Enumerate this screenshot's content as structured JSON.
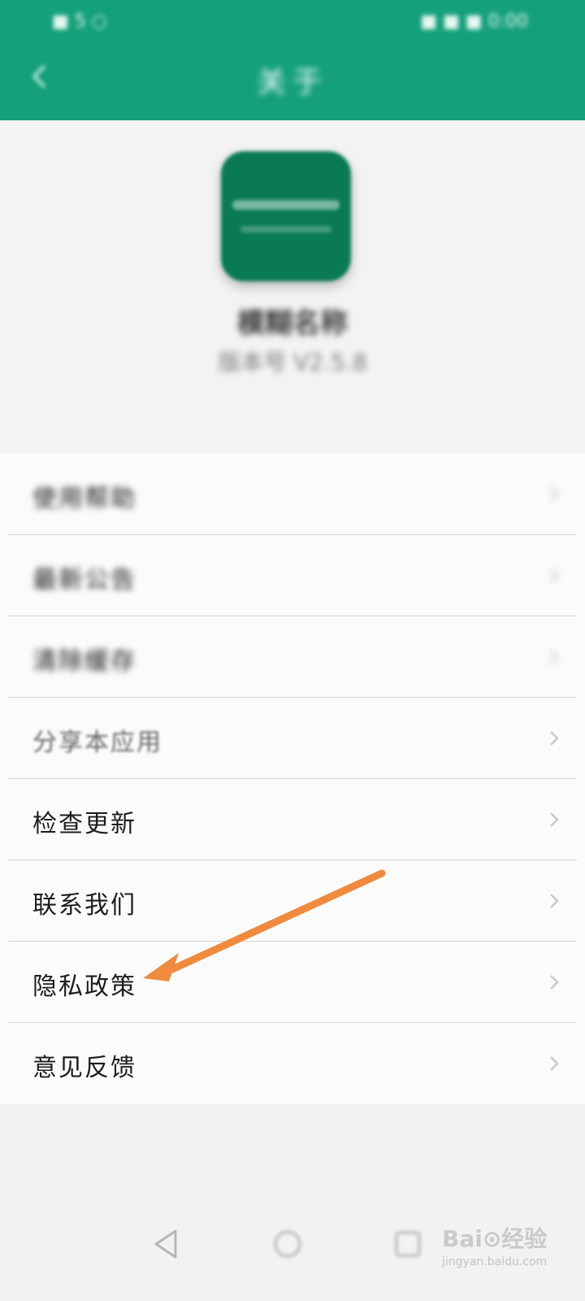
{
  "status_bar": {
    "left_text": "■ 5 ○",
    "right_text": "■ ■ ■ 0:00"
  },
  "header": {
    "title": "关于",
    "back_icon": "back-arrow-icon",
    "background_color": "#13a07a"
  },
  "app": {
    "name": "模糊名称",
    "version": "版本号 V2.5.8"
  },
  "menu": {
    "items": [
      {
        "label": "使用帮助",
        "state": "blurred"
      },
      {
        "label": "最新公告",
        "state": "blurred"
      },
      {
        "label": "清除缓存",
        "state": "blurred"
      },
      {
        "label": "分享本应用",
        "state": "faded"
      },
      {
        "label": "检查更新",
        "state": "clear"
      },
      {
        "label": "联系我们",
        "state": "clear"
      },
      {
        "label": "隐私政策",
        "state": "clear"
      },
      {
        "label": "意见反馈",
        "state": "clear"
      }
    ]
  },
  "annotation": {
    "arrow_color": "#f08a3c"
  },
  "nav_bar": {
    "back_icon": "triangle-back-icon",
    "home_icon": "circle-home-icon",
    "recent_icon": "square-recent-icon"
  },
  "watermark": {
    "brand": "Bai⊙经验",
    "url": "jingyan.baidu.com"
  }
}
